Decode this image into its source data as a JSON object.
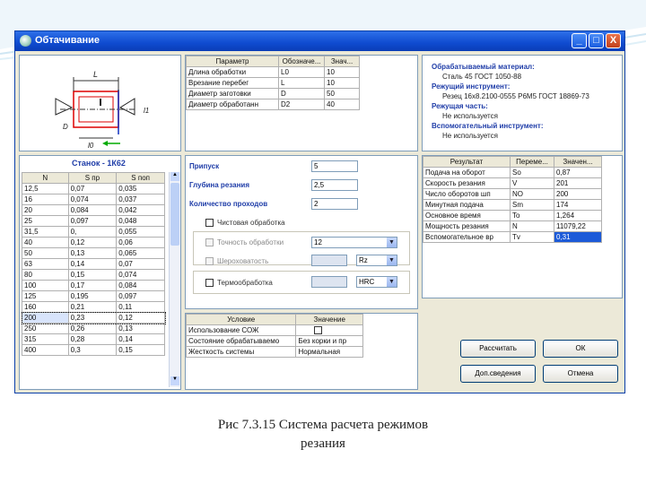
{
  "window": {
    "title": "Обтачивание"
  },
  "titlebar_buttons": {
    "minimize": "_",
    "maximize": "□",
    "close": "X"
  },
  "params_table": {
    "headers": [
      "Параметр",
      "Обозначе...",
      "Знач..."
    ],
    "rows": [
      [
        "Длина обработки",
        "L0",
        "10"
      ],
      [
        "Врезание перебег",
        "L",
        "10"
      ],
      [
        "Диаметр заготовки",
        "D",
        "50"
      ],
      [
        "Диаметр обработанн",
        "D2",
        "40"
      ]
    ]
  },
  "material_info": {
    "material_label": "Обрабатываемый материал:",
    "material_value": "Сталь 45 ГОСТ 1050-88",
    "tool_label": "Режущий инструмент:",
    "tool_value": "Резец 16х8.2100-0555 Р6М5 ГОСТ 18869-73",
    "cutting_part_label": "Режущая часть:",
    "cutting_part_value": "Не используется",
    "aux_tool_label": "Вспомогательный инструмент:",
    "aux_tool_value": "Не используется"
  },
  "machine_table": {
    "title": "Станок - 1К62",
    "headers": [
      "N",
      "S пр",
      "S поп"
    ],
    "rows": [
      [
        "12,5",
        "0,07",
        "0,035"
      ],
      [
        "16",
        "0,074",
        "0,037"
      ],
      [
        "20",
        "0,084",
        "0,042"
      ],
      [
        "25",
        "0,097",
        "0,048"
      ],
      [
        "31,5",
        "0,",
        "0,055"
      ],
      [
        "40",
        "0,12",
        "0,06"
      ],
      [
        "50",
        "0,13",
        "0,065"
      ],
      [
        "63",
        "0,14",
        "0,07"
      ],
      [
        "80",
        "0,15",
        "0,074"
      ],
      [
        "100",
        "0,17",
        "0,084"
      ],
      [
        "125",
        "0,195",
        "0,097"
      ],
      [
        "160",
        "0,21",
        "0,11"
      ],
      [
        "200",
        "0,23",
        "0,12"
      ],
      [
        "250",
        "0,26",
        "0,13"
      ],
      [
        "315",
        "0,28",
        "0,14"
      ],
      [
        "400",
        "0,3",
        "0,15"
      ]
    ],
    "selected_row": 12
  },
  "inputs": {
    "allowance_label": "Припуск",
    "allowance_value": "5",
    "depth_label": "Глубина резания",
    "depth_value": "2,5",
    "passes_label": "Количество проходов",
    "passes_value": "2"
  },
  "finishing": {
    "finish_label": "Чистовая обработка",
    "accuracy_label": "Точность обработки",
    "accuracy_value": "12",
    "roughness_label": "Шероховатость",
    "roughness_value": "Rz",
    "hardening_label": "Термообработка",
    "hardening_value": "HRC"
  },
  "conditions_table": {
    "headers": [
      "Условие",
      "Значение"
    ],
    "rows": [
      [
        "Использование СОЖ",
        ""
      ],
      [
        "Состояние обрабатываемо",
        "Без корки и пр"
      ],
      [
        "Жесткость системы",
        "Нормальная"
      ]
    ]
  },
  "results_table": {
    "headers": [
      "Результат",
      "Переме...",
      "Значен..."
    ],
    "rows": [
      [
        "Подача на оборот",
        "So",
        "0,87"
      ],
      [
        "Скорость резания",
        "V",
        "201"
      ],
      [
        "Число оборотов шп",
        "NO",
        "200"
      ],
      [
        "Минутная подача",
        "Sm",
        "174"
      ],
      [
        "Основное время",
        "To",
        "1,264"
      ],
      [
        "Мощность резания",
        "N",
        "11079,22"
      ],
      [
        "Вспомогательное вр",
        "Tv",
        "0,31"
      ]
    ]
  },
  "buttons": {
    "calculate": "Рассчитать",
    "ok": "ОК",
    "extra_info": "Доп.сведения",
    "cancel": "Отмена"
  },
  "diagram": {
    "dim_L": "L",
    "dim_D": "D",
    "dim_l1": "l1",
    "dim_l0": "l0"
  },
  "caption": {
    "line1": "Рис 7.3.15 Система расчета режимов",
    "line2": "резания"
  }
}
